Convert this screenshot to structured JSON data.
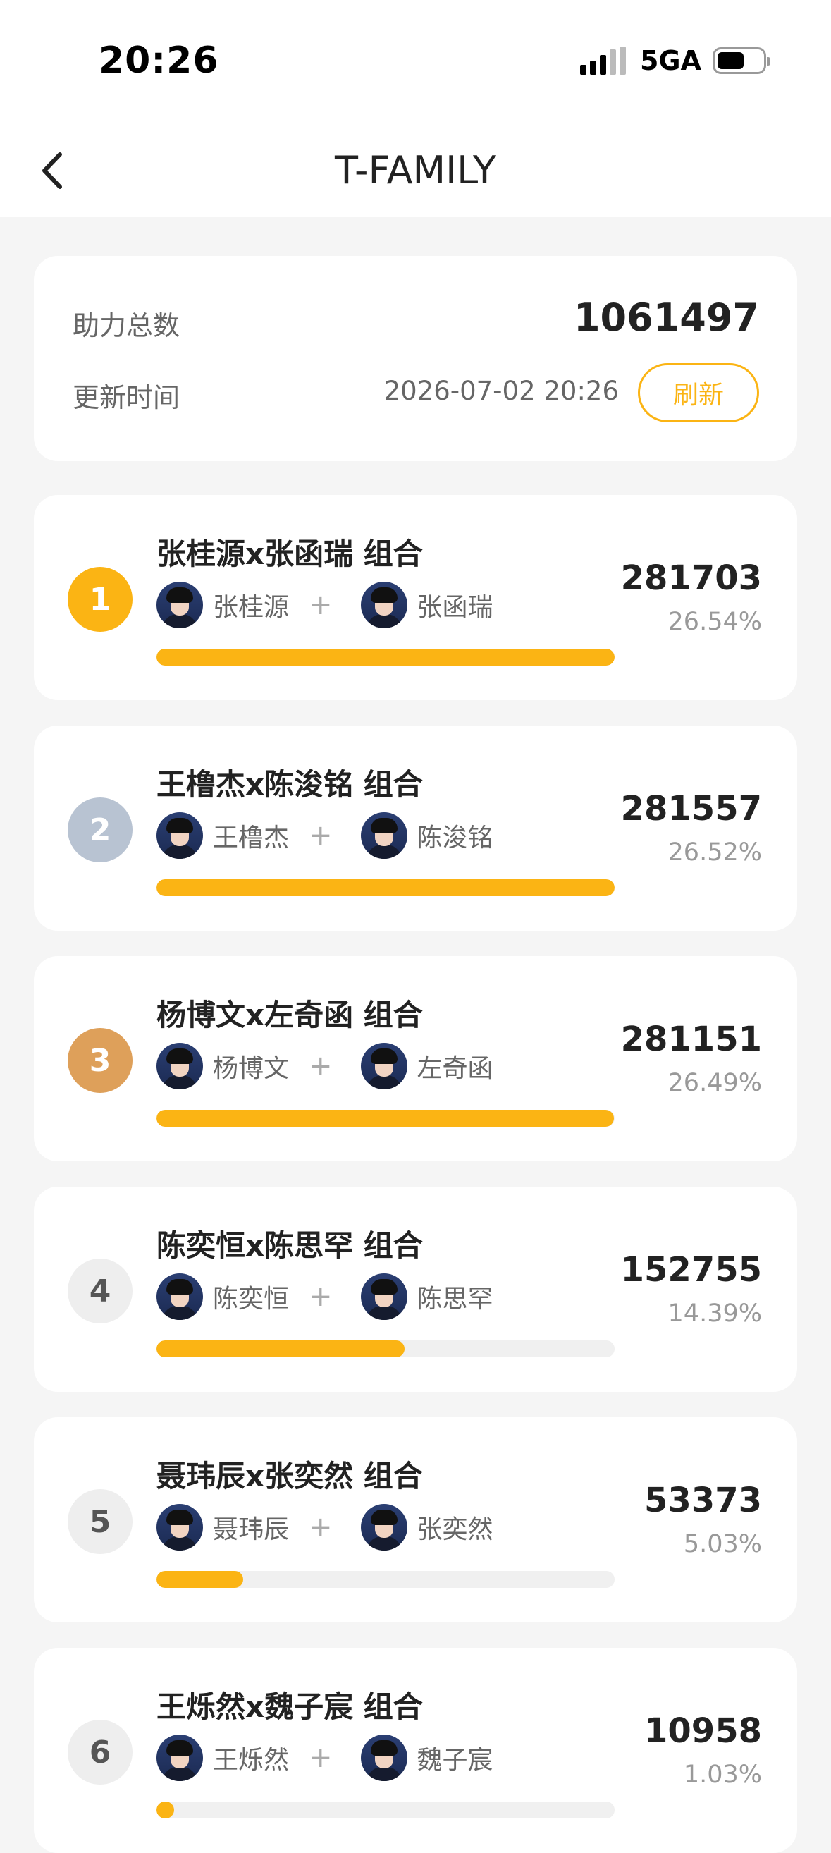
{
  "status_bar": {
    "time": "20:26",
    "network": "5GA"
  },
  "nav": {
    "title": "T-FAMILY"
  },
  "summary": {
    "total_label": "助力总数",
    "total_value": "1061497",
    "update_label": "更新时间",
    "update_time": "2026-07-02 20:26",
    "refresh_label": "刷新"
  },
  "colors": {
    "accent": "#fbb414",
    "rank_1": "#fbb414",
    "rank_2": "#b8c3d2",
    "rank_3": "#dea05a",
    "rank_other": "#eeeeee"
  },
  "groups": [
    {
      "rank": "1",
      "name": "张桂源x张函瑞 组合",
      "member_a": "张桂源",
      "member_b": "张函瑞",
      "votes": "281703",
      "percent": "26.54%",
      "share": 0.2654
    },
    {
      "rank": "2",
      "name": "王橹杰x陈浚铭 组合",
      "member_a": "王橹杰",
      "member_b": "陈浚铭",
      "votes": "281557",
      "percent": "26.52%",
      "share": 0.2652
    },
    {
      "rank": "3",
      "name": "杨博文x左奇函 组合",
      "member_a": "杨博文",
      "member_b": "左奇函",
      "votes": "281151",
      "percent": "26.49%",
      "share": 0.2649
    },
    {
      "rank": "4",
      "name": "陈奕恒x陈思罕 组合",
      "member_a": "陈奕恒",
      "member_b": "陈思罕",
      "votes": "152755",
      "percent": "14.39%",
      "share": 0.1439
    },
    {
      "rank": "5",
      "name": "聂玮辰x张奕然 组合",
      "member_a": "聂玮辰",
      "member_b": "张奕然",
      "votes": "53373",
      "percent": "5.03%",
      "share": 0.0503
    },
    {
      "rank": "6",
      "name": "王烁然x魏子宸 组合",
      "member_a": "王烁然",
      "member_b": "魏子宸",
      "votes": "10958",
      "percent": "1.03%",
      "share": 0.0103
    }
  ]
}
